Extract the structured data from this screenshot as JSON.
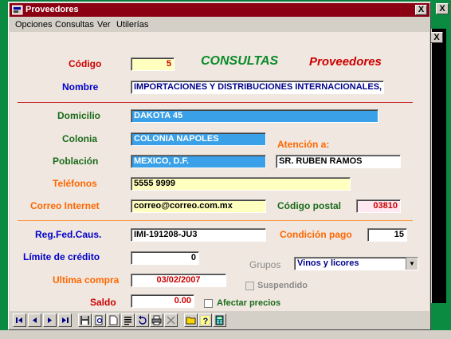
{
  "window": {
    "title": "Proveedores",
    "close_label": "X"
  },
  "menu": [
    "Opciones",
    "Consultas",
    "Ver",
    "Utilerías"
  ],
  "heading": {
    "left": "CONSULTAS",
    "right": "Proveedores"
  },
  "labels": {
    "codigo": "Código",
    "nombre": "Nombre",
    "domicilio": "Domicilio",
    "colonia": "Colonia",
    "atencion": "Atención a:",
    "poblacion": "Población",
    "telefonos": "Teléfonos",
    "correo": "Correo Internet",
    "codigo_postal": "Código postal",
    "rfc": "Reg.Fed.Caus.",
    "condicion_pago": "Condición pago",
    "limite_credito": "Límite de crédito",
    "grupos": "Grupos",
    "suspendido": "Suspendido",
    "ultima_compra": "Ultima compra",
    "saldo": "Saldo",
    "afectar_precios": "Afectar precios"
  },
  "values": {
    "codigo": "5",
    "nombre": "IMPORTACIONES Y DISTRIBUCIONES INTERNACIONALES, S",
    "domicilio": "DAKOTA 45",
    "colonia": "COLONIA NAPOLES",
    "poblacion": "MEXICO, D.F.",
    "atencion": "SR. RUBEN RAMOS",
    "telefonos": "5555 9999",
    "correo": "correo@correo.com.mx",
    "codigo_postal": "03810",
    "rfc": "IMI-191208-JU3",
    "condicion_pago": "15",
    "limite_credito": "0",
    "grupos": "Vinos y licores",
    "ultima_compra": "03/02/2007",
    "saldo": "0.00"
  },
  "background": {
    "close_label": "X"
  },
  "colors": {
    "title_bar": "#8b0012",
    "form_bg": "#f0e8e0",
    "blue_field": "#3aa0e8",
    "divider": "#cc3333"
  }
}
